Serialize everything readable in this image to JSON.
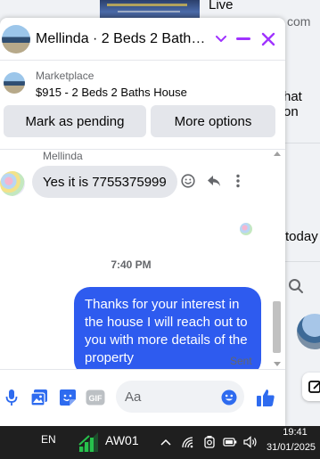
{
  "background": {
    "live_label": "Live",
    "com_fragment": "com",
    "hat_fragment": "hat on",
    "today_fragment": "today"
  },
  "chat": {
    "header": {
      "title": "Mellinda · 2 Beds 2 Baths ...",
      "accent_color": "#a033ff"
    },
    "listing": {
      "label": "Marketplace",
      "title": "$915 - 2 Beds 2 Baths House",
      "buttons": [
        "Mark as pending",
        "More options"
      ]
    },
    "messages": {
      "incoming_sender": "Mellinda",
      "incoming_text": "Yes it is 7755375999",
      "timestamp": "7:40 PM",
      "outgoing_text": "Thanks for your interest in the house I will reach out to you with more details of the property",
      "status": "Sent",
      "bubble_color": "#2e5bef"
    },
    "composer": {
      "placeholder": "Aa",
      "icons": [
        "microphone-icon",
        "photo-icon",
        "sticker-icon",
        "gif-icon",
        "emoji-icon",
        "like-icon"
      ]
    }
  },
  "taskbar": {
    "language": "EN",
    "network_name": "AW01",
    "time": "19:41",
    "date": "31/01/2025"
  }
}
